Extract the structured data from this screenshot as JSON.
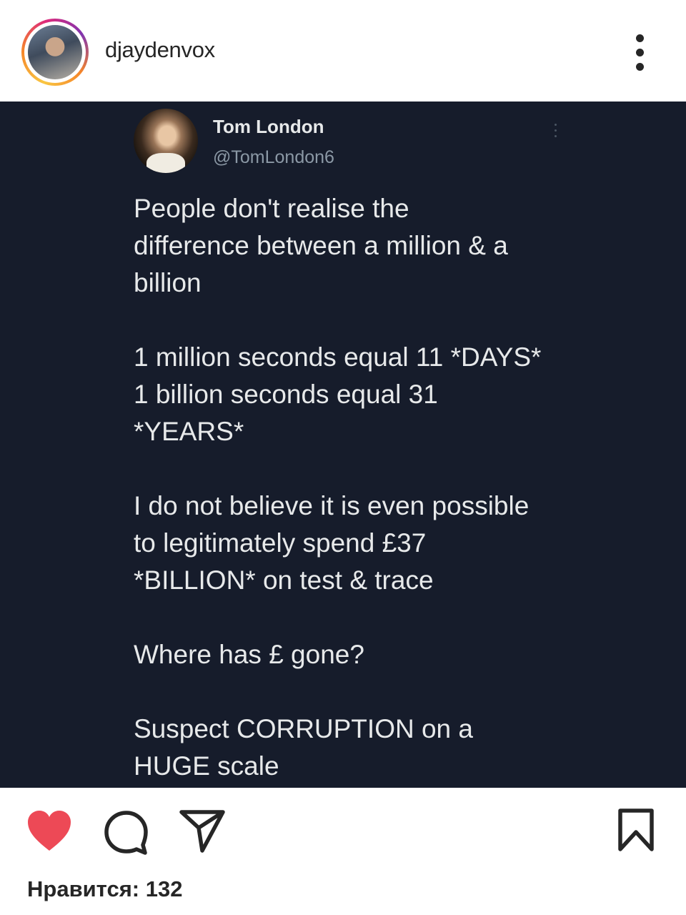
{
  "post_header": {
    "username": "djaydenvox"
  },
  "tweet": {
    "author_name": "Tom London",
    "author_handle": "@TomLondon6",
    "lines": [
      "People don't realise the",
      "difference between a million & a",
      "billion",
      "",
      "1 million seconds equal 11 *DAYS*",
      "1 billion seconds equal 31",
      "*YEARS*",
      "",
      "I do not believe it is even possible",
      "to legitimately spend £37",
      "*BILLION* on test & trace",
      "",
      "Where has £ gone?",
      "",
      "Suspect CORRUPTION on a",
      "HUGE scale"
    ]
  },
  "actions": {
    "like_icon": "heart-filled-icon",
    "comment_icon": "speech-bubble-icon",
    "share_icon": "paper-plane-icon",
    "save_icon": "bookmark-icon",
    "like_color": "#ed4956",
    "likes_text": "Нравится: 132"
  },
  "colors": {
    "post_background": "#161c2b",
    "tweet_text": "#e7e9ea",
    "tweet_secondary": "#8b98a5",
    "ui_text": "#262626"
  }
}
